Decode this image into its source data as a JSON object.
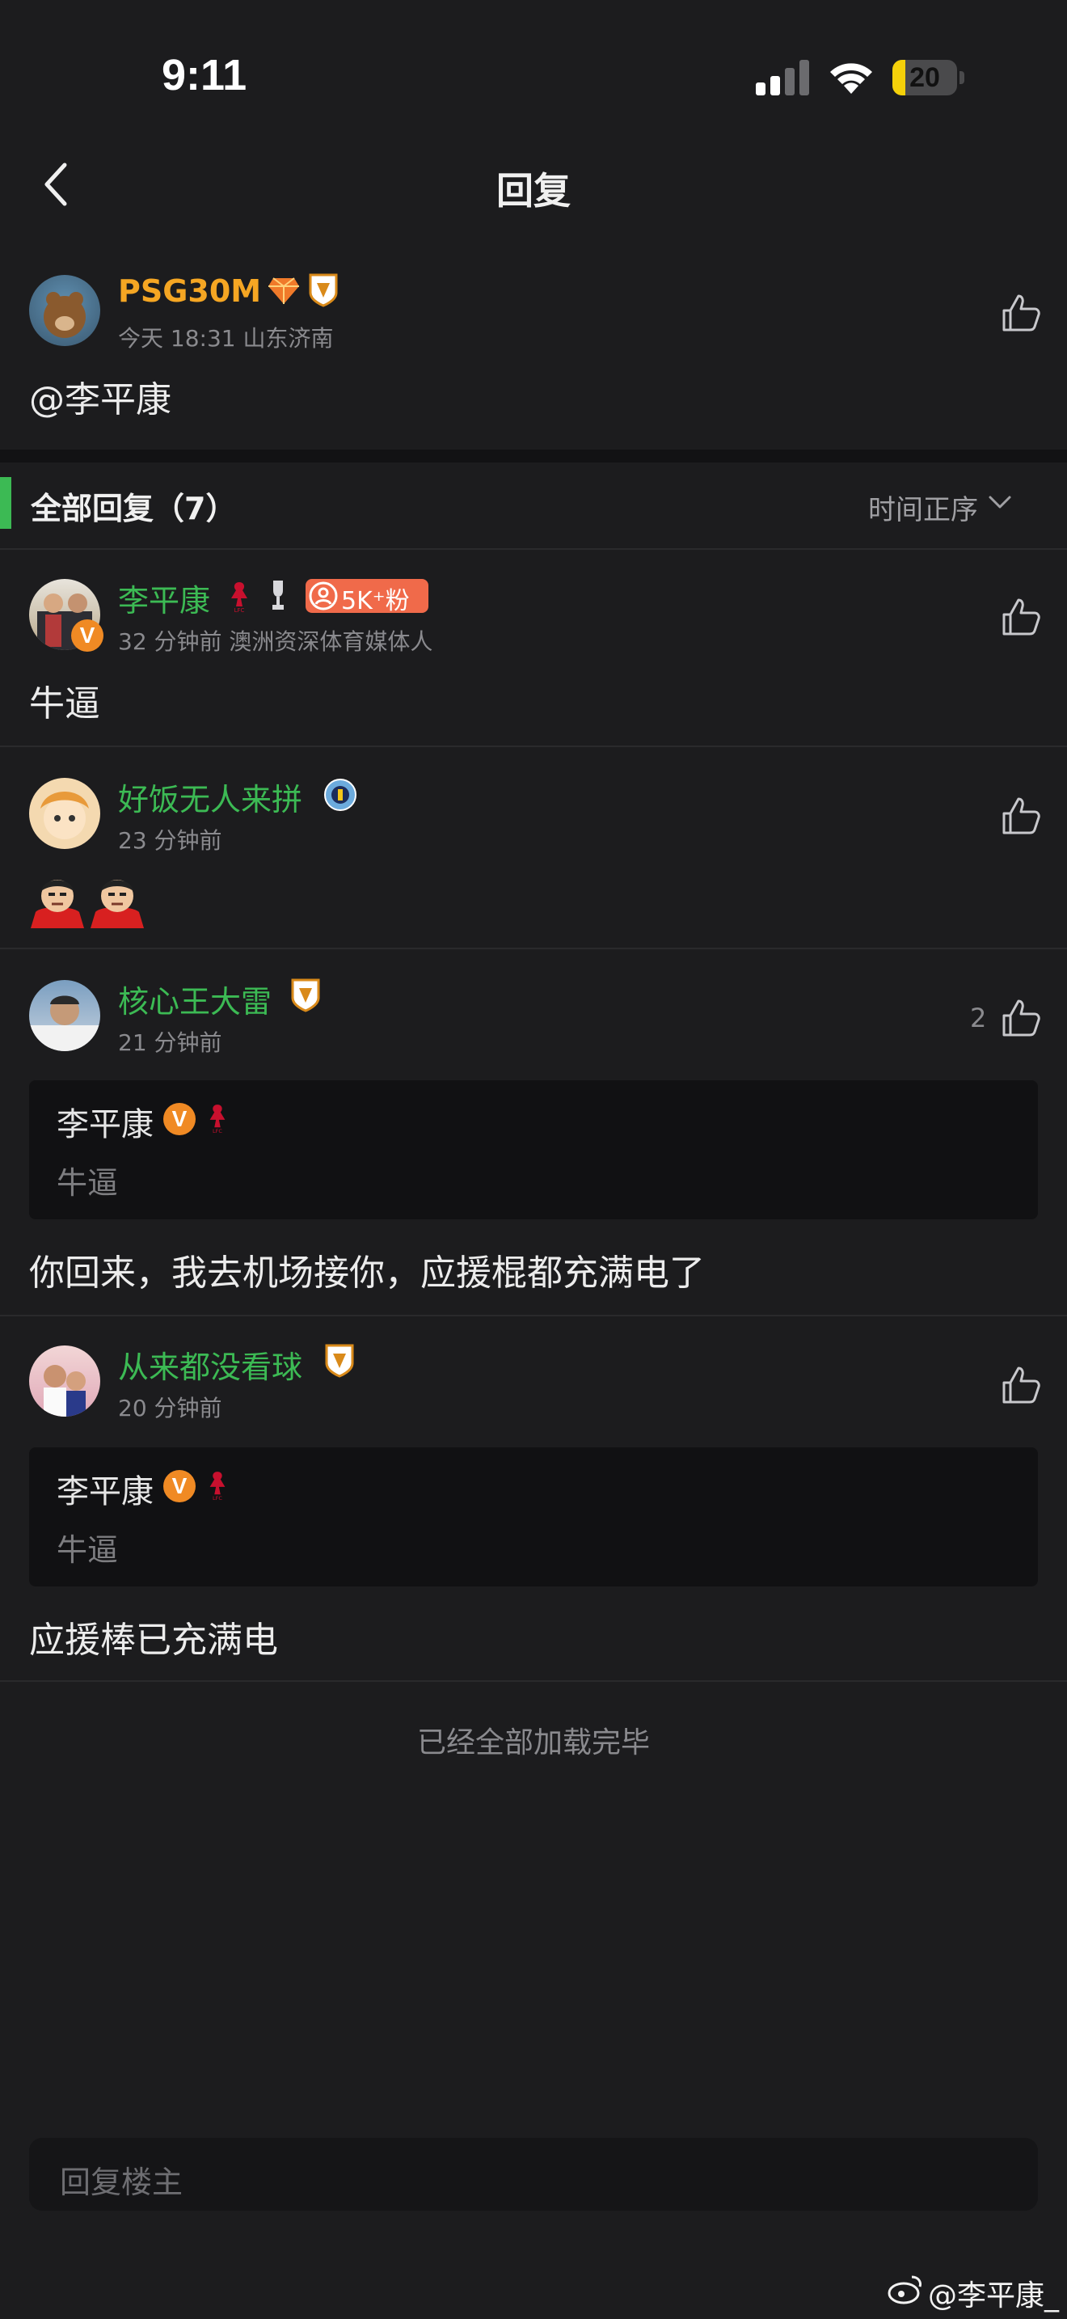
{
  "status_bar": {
    "time": "9:11",
    "battery": "20",
    "battery_level": 0.2
  },
  "nav": {
    "title": "回复"
  },
  "post": {
    "author": "PSG30M",
    "meta": "今天 18:31 山东济南",
    "text": "@李平康"
  },
  "section": {
    "title": "全部回复（7）",
    "sort_label": "时间正序"
  },
  "comments": [
    {
      "author": "李平康",
      "meta": "32 分钟前 澳洲资深体育媒体人",
      "fans_badge": "5K⁺粉",
      "text": "牛逼",
      "verified": "V"
    },
    {
      "author": "好饭无人来拼",
      "meta": "23 分钟前",
      "text": ""
    },
    {
      "author": "核心王大雷",
      "meta": "21 分钟前",
      "likes": "2",
      "quote": {
        "author": "李平康",
        "verified": "V",
        "text": "牛逼"
      },
      "text": "你回来，我去机场接你，应援棍都充满电了"
    },
    {
      "author": "从来都没看球",
      "meta": "20 分钟前",
      "quote": {
        "author": "李平康",
        "verified": "V",
        "text": "牛逼"
      },
      "text": "应援棒已充满电"
    }
  ],
  "load_done": "已经全部加载完毕",
  "reply_input": {
    "placeholder": "回复楼主"
  },
  "watermark": "@李平康_",
  "colors": {
    "accent_green": "#3cba54",
    "name_orange": "#f5a623",
    "background": "#1c1c1e"
  },
  "icons": [
    "back-chevron-icon",
    "like-icon",
    "signal-icon",
    "wifi-icon",
    "battery-icon",
    "chevron-down-icon",
    "weibo-icon"
  ]
}
